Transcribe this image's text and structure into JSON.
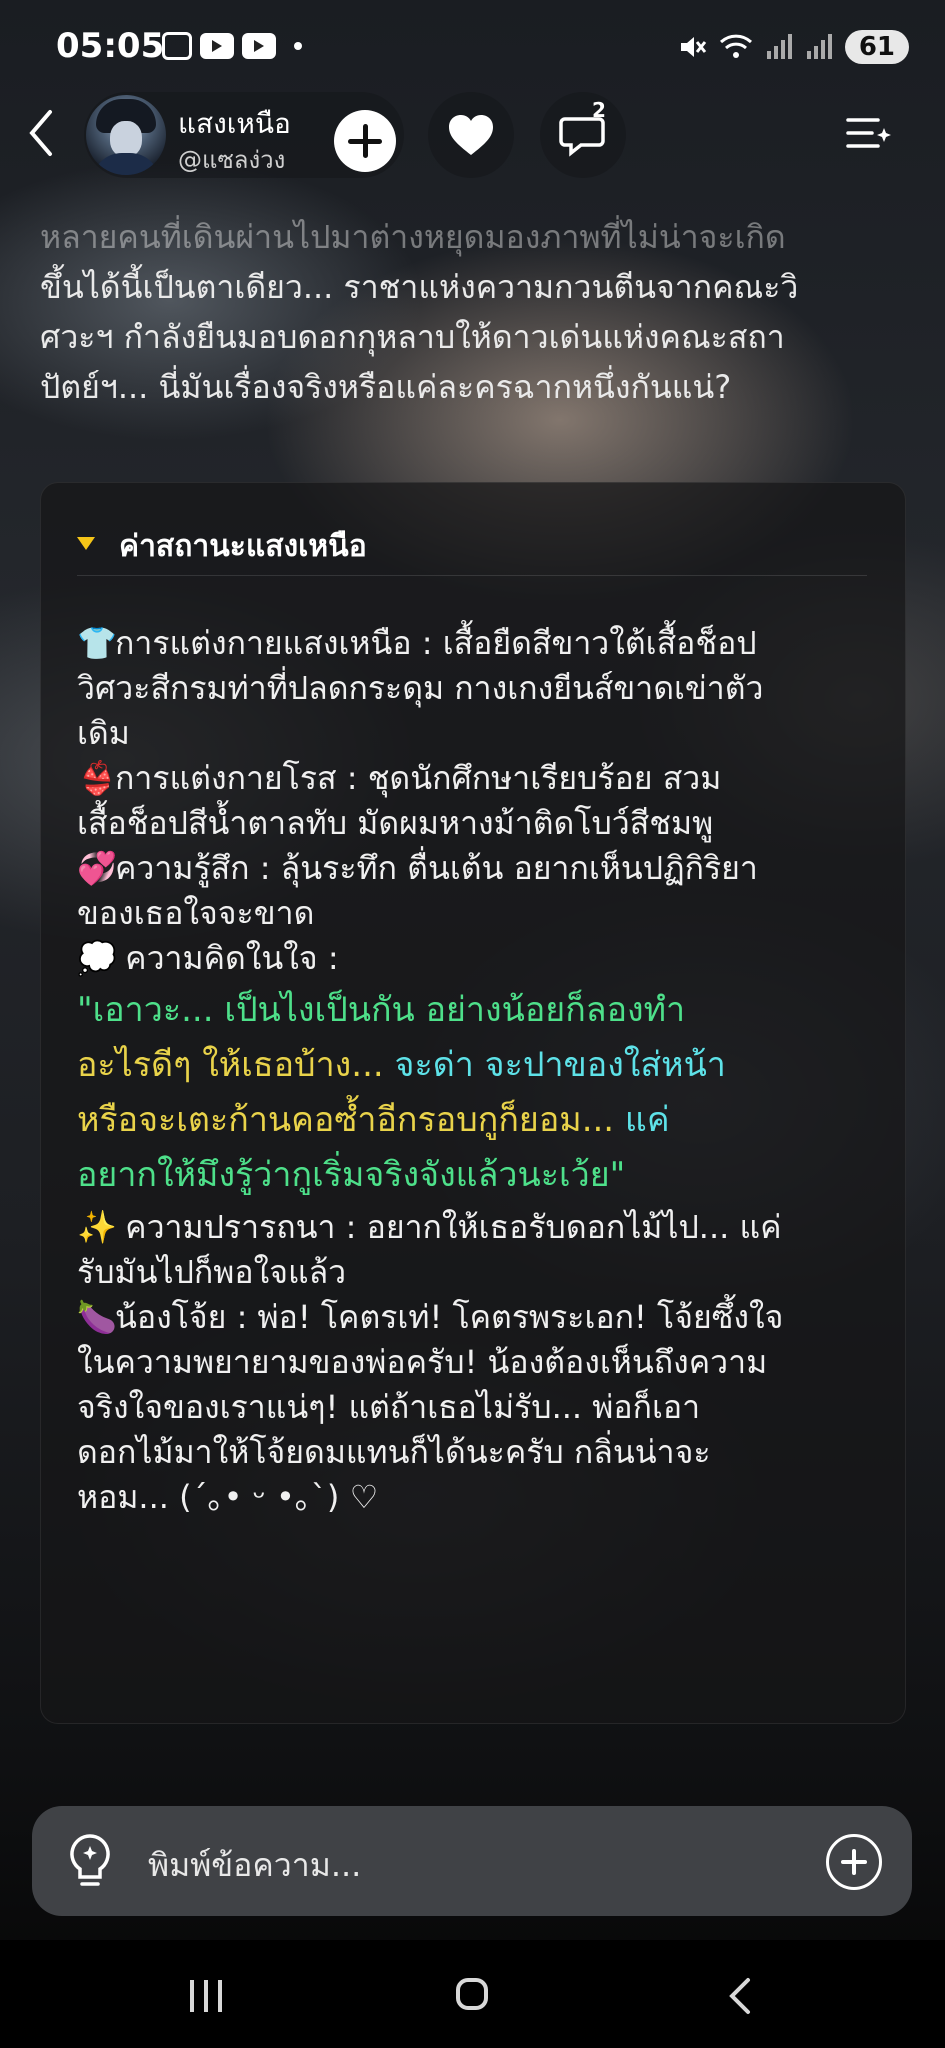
{
  "status_bar": {
    "time": "05:05",
    "battery": "61"
  },
  "header": {
    "character_name": "แสงเหนือ",
    "character_handle": "@แซลง่วง",
    "comment_count": "2"
  },
  "narration": {
    "line1": "หลายคนที่เดินผ่านไปมาต่างหยุดมองภาพที่ไม่น่าจะเกิด",
    "line2": "ขึ้นได้นี้เป็นตาเดียว... ราชาแห่งความกวนตีนจากคณะวิ",
    "line3": "ศวะฯ กำลังยืนมอบดอกกุหลาบให้ดาวเด่นแห่งคณะสถา",
    "line4": "ปัตย์ฯ... นี่มันเรื่องจริงหรือแค่ละครฉากหนึ่งกันแน่?"
  },
  "status_card": {
    "title": "ค่าสถานะแสงเหนือ",
    "outfit_emoji": "👕",
    "outfit_l1": "การแต่งกายแสงเหนือ : เสื้อยืดสีขาวใต้เสื้อช็อป",
    "outfit_l2": "วิศวะสีกรมท่าที่ปลดกระดุม กางเกงยีนส์ขาดเข่าตัว",
    "outfit_l3": "เดิม",
    "rose_emoji": "👙",
    "rose_l1": "การแต่งกายโรส : ชุดนักศึกษาเรียบร้อย สวม",
    "rose_l2": "เสื้อช็อปสีน้ำตาลทับ มัดผมหางม้าติดโบว์สีชมพู",
    "feel_emoji": "💞",
    "feel_l1": "ความรู้สึก : ลุ้นระทึก ตื่นเต้น อยากเห็นปฏิกิริยา",
    "feel_l2": "ของเธอใจจะขาด",
    "thought_emoji": "💭",
    "thought_label": "ความคิดในใจ :",
    "quote_l1": "\"เอาวะ... เป็นไงเป็นกัน อย่างน้อยก็ลองทำ",
    "quote_l2a": "อะไรดีๆ ให้เธอบ้าง... ",
    "quote_l2b": "จะด่า จะปาของใส่หน้า",
    "quote_l3a": "หรือจะเตะก้านคอซ้ำอีกรอบกูก็ยอม... ",
    "quote_l3b": "แค่",
    "quote_l4": "อยากให้มึงรู้ว่ากูเริ่มจริงจังแล้วนะเว้ย\"",
    "wish_emoji": "✨",
    "wish_l1": "ความปรารถนา : อยากให้เธอรับดอกไม้ไป... แค่",
    "wish_l2": "รับมันไปก็พอใจแล้ว",
    "jo_emoji": "🍆",
    "jo_l1": "น้องโจ้ย : พ่อ! โคตรเท่! โคตรพระเอก! โจ้ยซึ้งใจ",
    "jo_l2": "ในความพยายามของพ่อครับ! น้องต้องเห็นถึงความ",
    "jo_l3": "จริงใจของเราแน่ๆ! แต่ถ้าเธอไม่รับ... พ่อก็เอา",
    "jo_l4": "ดอกไม้มาให้โจ้ยดมแทนก็ได้นะครับ กลิ่นน่าจะ",
    "jo_l5": "หอม... (´｡• ᵕ •｡`) ♡"
  },
  "input": {
    "placeholder": "พิมพ์ข้อความ..."
  },
  "colors": {
    "accent_yellow": "#f5c518",
    "quote_green": "#4ee08a",
    "quote_yellow": "#e9d34a",
    "quote_cyan": "#5ee2e8"
  }
}
